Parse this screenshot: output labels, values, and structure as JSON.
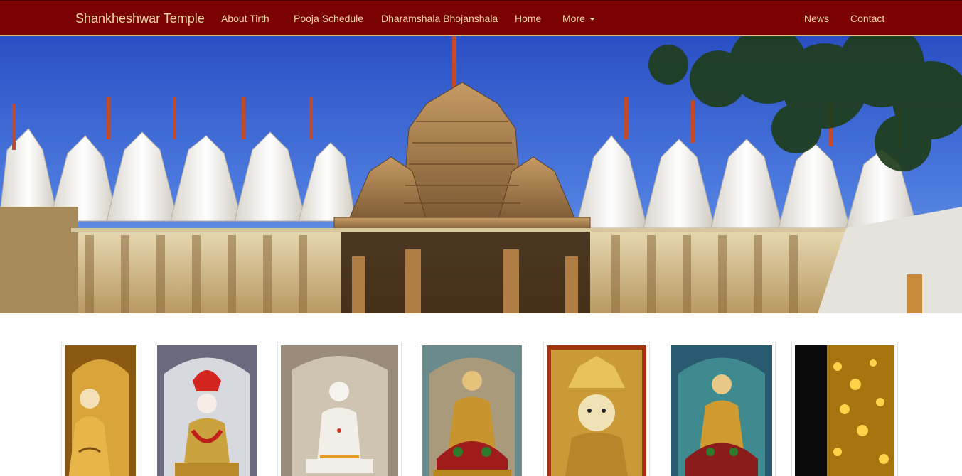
{
  "navbar": {
    "brand": "Shankheshwar Temple",
    "links": {
      "about": "About Tirth",
      "pooja": "Pooja Schedule",
      "dharamshala": "Dharamshala Bhojanshala",
      "home": "Home",
      "more": "More",
      "news": "News",
      "contact": "Contact"
    },
    "colors": {
      "background": "#7a0202",
      "text": "#efd8a8"
    }
  },
  "hero": {
    "icon": "temple-banner-image"
  },
  "gallery": {
    "items": [
      {
        "icon": "golden-idol-image"
      },
      {
        "icon": "silver-idol-with-red-crown-image"
      },
      {
        "icon": "white-marble-idol-image"
      },
      {
        "icon": "golden-seated-idol-image"
      },
      {
        "icon": "golden-face-idol-image"
      },
      {
        "icon": "blue-shrine-idol-image"
      },
      {
        "icon": "golden-sparkle-image"
      }
    ]
  }
}
